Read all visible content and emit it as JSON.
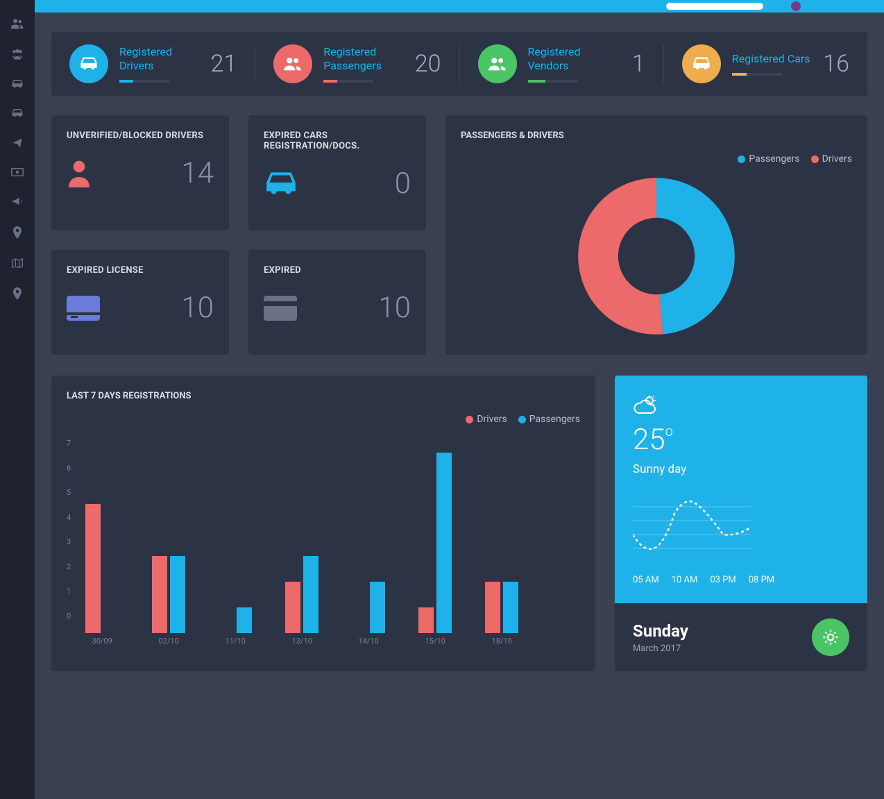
{
  "stats": [
    {
      "label": "Registered Drivers",
      "value": "21",
      "color": "blue"
    },
    {
      "label": "Registered Passengers",
      "value": "20",
      "color": "red"
    },
    {
      "label": "Registered Vendors",
      "value": "1",
      "color": "green"
    },
    {
      "label": "Registered Cars",
      "value": "16",
      "color": "orange"
    }
  ],
  "cards": {
    "unverified": {
      "title": "UNVERIFIED/BLOCKED DRIVERS",
      "value": "14"
    },
    "expiredCars": {
      "title": "EXPIRED CARS REGISTRATION/DOCS.",
      "value": "0"
    },
    "expiredLicense": {
      "title": "EXPIRED LICENSE",
      "value": "10"
    },
    "expired": {
      "title": "EXPIRED",
      "value": "10"
    }
  },
  "donut": {
    "title": "PASSENGERS & DRIVERS",
    "legend": [
      "Passengers",
      "Drivers"
    ]
  },
  "barChart": {
    "title": "LAST 7 DAYS REGISTRATIONS",
    "legend": [
      "Drivers",
      "Passengers"
    ],
    "yLabels": [
      "7",
      "6",
      "5",
      "4",
      "3",
      "2",
      "1",
      "0"
    ]
  },
  "weather": {
    "temp": "25",
    "unit": "o",
    "desc": "Sunny day",
    "hours": [
      "05 AM",
      "10 AM",
      "03 PM",
      "08 PM"
    ],
    "day": "Sunday",
    "date": "March 2017"
  },
  "chart_data": [
    {
      "type": "pie",
      "title": "Passengers & Drivers",
      "series": [
        {
          "name": "Passengers",
          "value": 20
        },
        {
          "name": "Drivers",
          "value": 21
        }
      ]
    },
    {
      "type": "bar",
      "title": "Last 7 Days Registrations",
      "categories": [
        "30/09",
        "02/10",
        "11/10",
        "13/10",
        "14/10",
        "15/10",
        "18/10"
      ],
      "series": [
        {
          "name": "Drivers",
          "values": [
            5,
            3,
            0,
            2,
            0,
            1,
            2
          ]
        },
        {
          "name": "Passengers",
          "values": [
            0,
            3,
            1,
            3,
            2,
            7,
            2
          ]
        }
      ],
      "ylim": [
        0,
        7
      ]
    }
  ]
}
